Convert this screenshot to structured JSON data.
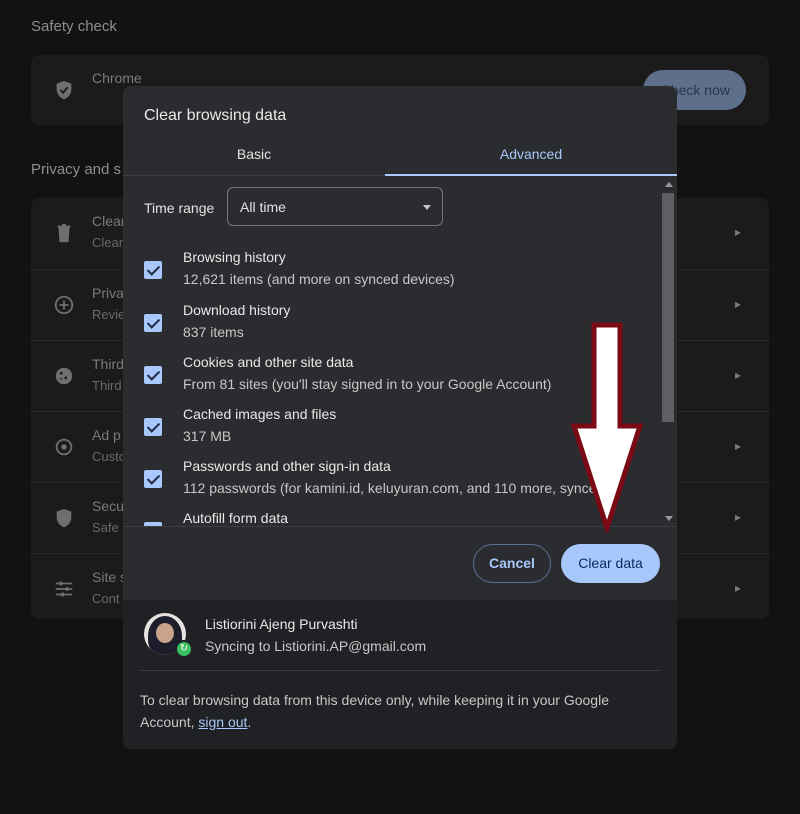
{
  "background": {
    "safety_check_title": "Safety check",
    "safety_check_row_text": "Chrome",
    "check_now_label": "Check now",
    "privacy_section_title": "Privacy and s",
    "privacy_rows": [
      {
        "title": "Clear",
        "sub": "Clear"
      },
      {
        "title": "Priva",
        "sub": "Revie"
      },
      {
        "title": "Third",
        "sub": "Third"
      },
      {
        "title": "Ad p",
        "sub": "Custo"
      },
      {
        "title": "Secu",
        "sub": "Safe"
      },
      {
        "title": "Site s",
        "sub": "Cont"
      }
    ]
  },
  "dialog": {
    "title": "Clear browsing data",
    "tabs": {
      "basic": "Basic",
      "advanced": "Advanced"
    },
    "time_range": {
      "label": "Time range",
      "value": "All time"
    },
    "items": [
      {
        "title": "Browsing history",
        "sub": "12,621 items (and more on synced devices)",
        "checked": true
      },
      {
        "title": "Download history",
        "sub": "837 items",
        "checked": true
      },
      {
        "title": "Cookies and other site data",
        "sub": "From 81 sites (you'll stay signed in to your Google Account)",
        "checked": true
      },
      {
        "title": "Cached images and files",
        "sub": "317 MB",
        "checked": true
      },
      {
        "title": "Passwords and other sign-in data",
        "sub": "112 passwords (for kamini.id, keluyuran.com, and 110 more, synced)",
        "checked": true
      },
      {
        "title": "Autofill form data",
        "sub": "",
        "checked": true
      }
    ],
    "buttons": {
      "cancel": "Cancel",
      "clear": "Clear data"
    },
    "account": {
      "name": "Listiorini Ajeng Purvashti",
      "sync_text": "Syncing to Listiorini.AP@gmail.com"
    },
    "note": {
      "text_before": "To clear browsing data from this device only, while keeping it in your Google Account, ",
      "link": "sign out",
      "text_after": "."
    }
  },
  "colors": {
    "accent": "#a8c7fa",
    "dialog_bg": "#2b2c2f",
    "annotation_arrow": "#7a0a14"
  }
}
